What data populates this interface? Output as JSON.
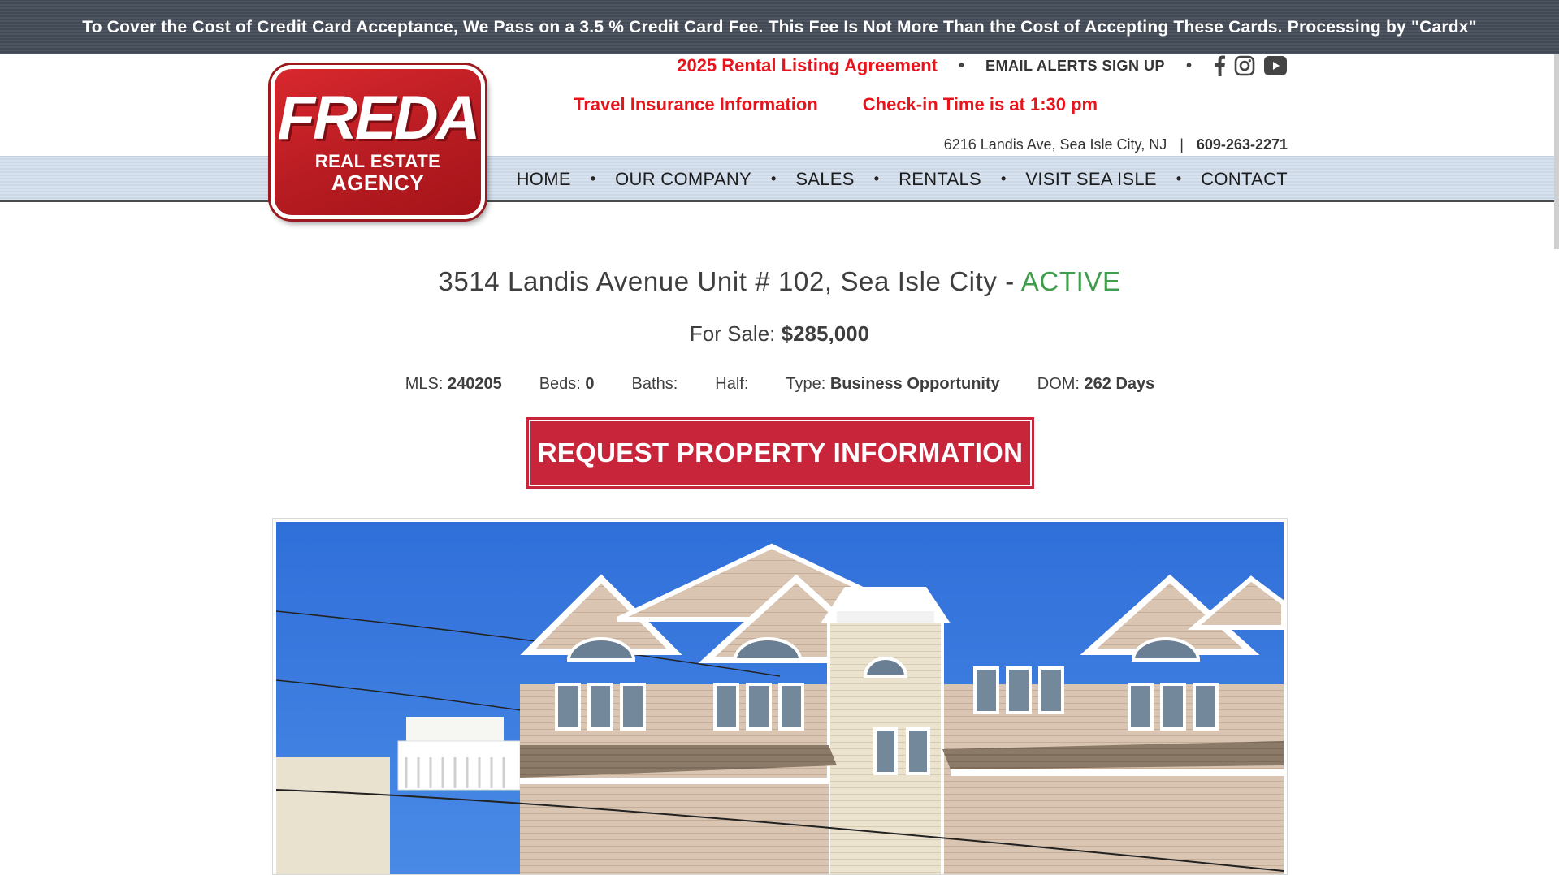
{
  "notice": {
    "text": "To Cover the Cost of Credit Card Acceptance, We Pass on a 3.5 % Credit Card Fee. This Fee Is Not More Than the Cost of Accepting These Cards. Processing by \"Cardx\""
  },
  "logo": {
    "main": "FREDA",
    "line2": "REAL ESTATE",
    "line3": "AGENCY"
  },
  "header": {
    "rental_listing_agreement": "2025 Rental Listing Agreement",
    "email_alerts": "EMAIL ALERTS SIGN UP",
    "travel_insurance": "Travel Insurance Information",
    "checkin_time": "Check-in Time is at 1:30 pm",
    "address": "6216 Landis Ave, Sea Isle City, NJ",
    "separator": "|",
    "phone": "609-263-2271",
    "social_icons": [
      "facebook-icon",
      "instagram-icon",
      "youtube-icon"
    ]
  },
  "nav": {
    "items": [
      "HOME",
      "OUR COMPANY",
      "SALES",
      "RENTALS",
      "VISIT SEA ISLE",
      "CONTACT"
    ]
  },
  "listing": {
    "address": "3514 Landis Avenue Unit # 102, Sea Isle City",
    "dash": " - ",
    "status": "ACTIVE",
    "price_label": "For Sale:",
    "price": "$285,000",
    "mls_label": "MLS:",
    "mls": "240205",
    "beds_label": "Beds:",
    "beds": "0",
    "baths_label": "Baths:",
    "baths": "",
    "half_label": "Half:",
    "half": "",
    "type_label": "Type:",
    "type": "Business Opportunity",
    "dom_label": "DOM:",
    "dom": "262 Days",
    "request_button": "REQUEST PROPERTY INFORMATION"
  },
  "colors": {
    "accent_red": "#e8141c",
    "button_red": "#c8243a",
    "status_green": "#3f9e4b",
    "notice_bg": "#4a525d",
    "nav_band": "#d3deec"
  }
}
